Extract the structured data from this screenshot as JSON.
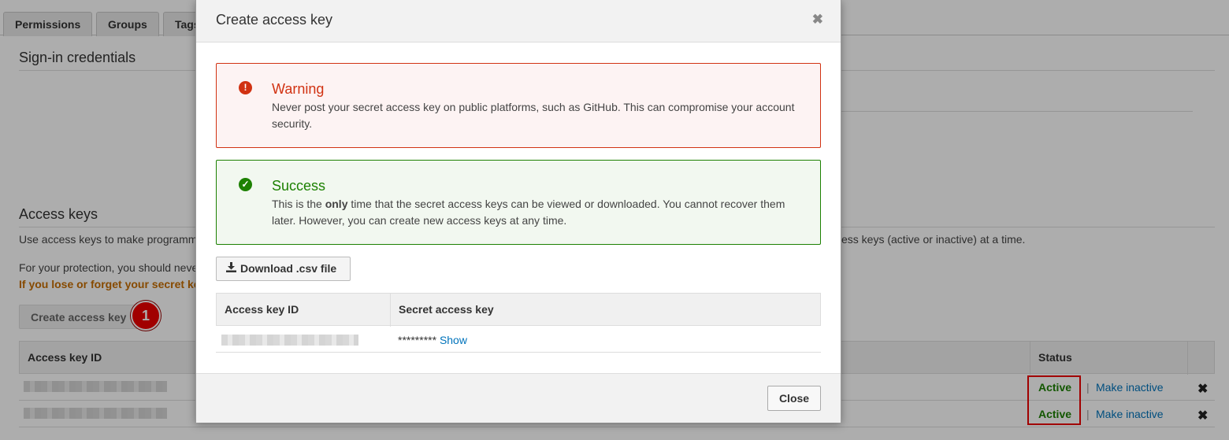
{
  "tabs": [
    "Permissions",
    "Groups",
    "Tags"
  ],
  "background": {
    "signin_title": "Sign-in credentials",
    "access_keys_title": "Access keys",
    "desc_left": "Use access keys to make programm",
    "desc_right": "ess keys (active or inactive) at a time.",
    "protection": "For your protection, you should neve",
    "lose_warning": "If you lose or forget your secret ke",
    "create_btn": "Create access key",
    "badge": "1",
    "table_col_id": "Access key ID",
    "table_col_status": "Status",
    "rows": [
      {
        "status": "Active",
        "action": "Make inactive"
      },
      {
        "status": "Active",
        "action": "Make inactive"
      }
    ],
    "separator": "|",
    "delete_icon": "✖"
  },
  "modal": {
    "title": "Create access key",
    "close_icon": "✖",
    "warning": {
      "icon": "!",
      "title": "Warning",
      "body": "Never post your secret access key on public platforms, such as GitHub. This can compromise your account security."
    },
    "success": {
      "icon": "✓",
      "title": "Success",
      "body_pre": "This is the ",
      "body_bold": "only",
      "body_post": " time that the secret access keys can be viewed or downloaded. You cannot recover them later. However, you can create new access keys at any time."
    },
    "download_label": "Download .csv file",
    "table": {
      "col_id": "Access key ID",
      "col_secret": "Secret access key",
      "secret_masked": "*********",
      "show_label": "Show"
    },
    "close_label": "Close"
  },
  "colors": {
    "warning": "#d13212",
    "success": "#1d8102",
    "link": "#0073bb",
    "highlight": "#ee0000"
  }
}
